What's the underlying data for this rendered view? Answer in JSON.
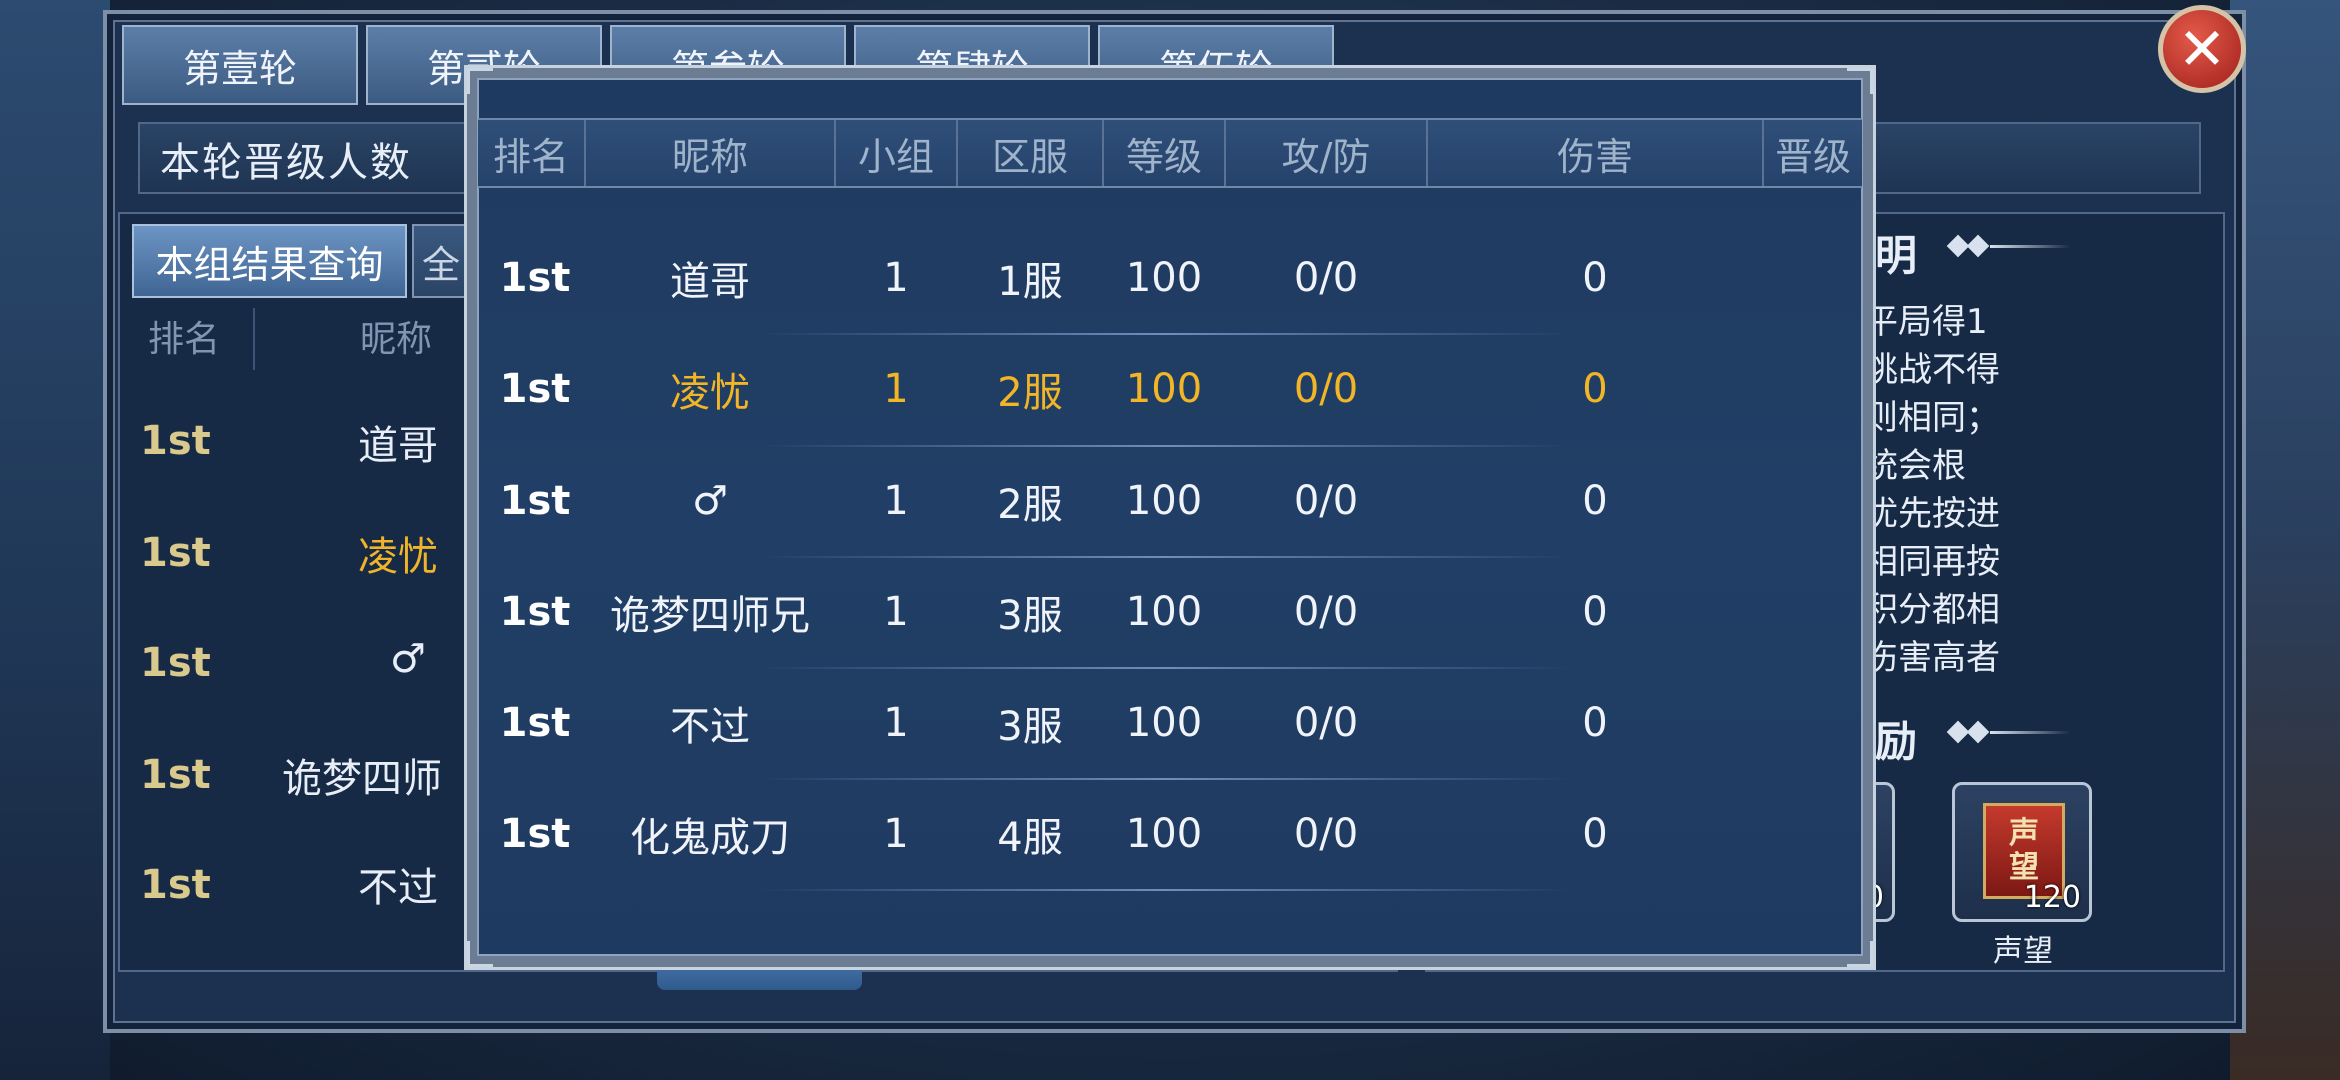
{
  "round_tabs": [
    "第壹轮",
    "第贰轮",
    "第叁轮",
    "第肆轮",
    "第伍轮"
  ],
  "round_info_label": "本轮晋级人数",
  "sub_tabs": {
    "active": "本组结果查询",
    "other": "全"
  },
  "background_table": {
    "headers": [
      "排名",
      "昵称"
    ],
    "rows": [
      {
        "rank": "1st",
        "name": "道哥",
        "highlight": false
      },
      {
        "rank": "1st",
        "name": "凌忧",
        "highlight": true
      },
      {
        "rank": "1st",
        "name": "♂",
        "highlight": false
      },
      {
        "rank": "1st",
        "name": "诡梦四师",
        "highlight": false
      },
      {
        "rank": "1st",
        "name": "不过",
        "highlight": false
      }
    ]
  },
  "right_panel": {
    "title_rules": "明",
    "rules_lines": [
      "，平局得1",
      "不挑战不得",
      "规则相同；",
      "系统会根",
      "，优先按进",
      "分相同再按",
      "防积分都相",
      "总伤害高者"
    ],
    "title_rewards": "励",
    "reward_item": {
      "name": "声望",
      "count": "120",
      "banner_text_top": "声",
      "banner_text_bottom": "望"
    },
    "partial_item_count": "0"
  },
  "modal": {
    "headers": [
      "排名",
      "昵称",
      "小组",
      "区服",
      "等级",
      "攻/防",
      "伤害",
      "晋级"
    ],
    "rows": [
      {
        "rank": "1st",
        "name": "道哥",
        "group": "1",
        "server": "1服",
        "level": "100",
        "atk_def": "0/0",
        "damage": "0",
        "promote": "",
        "highlight": false
      },
      {
        "rank": "1st",
        "name": "凌忧",
        "group": "1",
        "server": "2服",
        "level": "100",
        "atk_def": "0/0",
        "damage": "0",
        "promote": "",
        "highlight": true
      },
      {
        "rank": "1st",
        "name": "♂",
        "group": "1",
        "server": "2服",
        "level": "100",
        "atk_def": "0/0",
        "damage": "0",
        "promote": "",
        "highlight": false
      },
      {
        "rank": "1st",
        "name": "诡梦四师兄",
        "group": "1",
        "server": "3服",
        "level": "100",
        "atk_def": "0/0",
        "damage": "0",
        "promote": "",
        "highlight": false
      },
      {
        "rank": "1st",
        "name": "不过",
        "group": "1",
        "server": "3服",
        "level": "100",
        "atk_def": "0/0",
        "damage": "0",
        "promote": "",
        "highlight": false
      },
      {
        "rank": "1st",
        "name": "化鬼成刀",
        "group": "1",
        "server": "4服",
        "level": "100",
        "atk_def": "0/0",
        "damage": "0",
        "promote": "",
        "highlight": false
      }
    ]
  },
  "colors": {
    "highlight": "#f2b526",
    "panel": "#1f3a60",
    "frame": "#c8d3e0"
  },
  "icons": {
    "close": "close-x-icon",
    "reward": "reputation-banner-icon"
  }
}
